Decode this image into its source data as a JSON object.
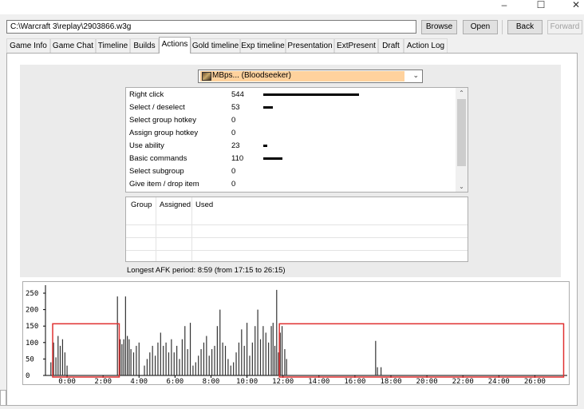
{
  "window": {
    "minimize": "–",
    "maximize": "☐",
    "close": "✕"
  },
  "toolbar": {
    "path": "C:\\Warcraft 3\\replay\\2903866.w3g",
    "browse": "Browse",
    "open": "Open",
    "back": "Back",
    "forward": "Forward"
  },
  "tabs": [
    "Game Info",
    "Game Chat",
    "Timeline",
    "Builds",
    "Actions",
    "Gold timeline",
    "Exp timeline",
    "Presentation",
    "ExtPresent",
    "Draft",
    "Action Log"
  ],
  "active_tab": "Actions",
  "player": {
    "name": "MBps... (Bloodseeker)",
    "highlight_color": "#ffd29d"
  },
  "actions": [
    {
      "name": "Right click",
      "value": 544
    },
    {
      "name": "Select / deselect",
      "value": 53
    },
    {
      "name": "Select group hotkey",
      "value": 0
    },
    {
      "name": "Assign group hotkey",
      "value": 0
    },
    {
      "name": "Use ability",
      "value": 23
    },
    {
      "name": "Basic commands",
      "value": 110
    },
    {
      "name": "Select subgroup",
      "value": 0
    },
    {
      "name": "Give item / drop item",
      "value": 0
    }
  ],
  "group_table": {
    "headers": [
      "Group",
      "Assigned",
      "Used"
    ]
  },
  "afk_text": "Longest AFK period: 8:59 (from 17:15 to 26:15)",
  "chart_data": {
    "type": "bar",
    "y_ticks": [
      "250",
      "200",
      "150",
      "100",
      "50",
      "0"
    ],
    "ylim": [
      0,
      250
    ],
    "x_ticks": [
      "0:00",
      "2:00",
      "4:00",
      "6:00",
      "8:00",
      "10:00",
      "12:00",
      "14:00",
      "16:00",
      "18:00",
      "20:00",
      "22:00",
      "24:00",
      "26:00"
    ],
    "xlim_minutes": [
      -1.2,
      27.8
    ],
    "values": [
      [
        -0.9,
        40
      ],
      [
        -0.75,
        100
      ],
      [
        -0.62,
        55
      ],
      [
        -0.5,
        120
      ],
      [
        -0.38,
        90
      ],
      [
        -0.25,
        110
      ],
      [
        -0.12,
        70
      ],
      [
        0.0,
        30
      ],
      [
        2.8,
        240
      ],
      [
        2.95,
        110
      ],
      [
        3.05,
        95
      ],
      [
        3.15,
        110
      ],
      [
        3.25,
        240
      ],
      [
        3.35,
        120
      ],
      [
        3.45,
        110
      ],
      [
        3.55,
        80
      ],
      [
        3.7,
        70
      ],
      [
        3.85,
        90
      ],
      [
        4.0,
        100
      ],
      [
        4.3,
        30
      ],
      [
        4.45,
        50
      ],
      [
        4.6,
        70
      ],
      [
        4.75,
        90
      ],
      [
        4.9,
        60
      ],
      [
        5.05,
        100
      ],
      [
        5.2,
        130
      ],
      [
        5.35,
        90
      ],
      [
        5.5,
        100
      ],
      [
        5.65,
        70
      ],
      [
        5.8,
        110
      ],
      [
        5.95,
        70
      ],
      [
        6.1,
        90
      ],
      [
        6.25,
        50
      ],
      [
        6.4,
        110
      ],
      [
        6.55,
        150
      ],
      [
        6.7,
        80
      ],
      [
        6.85,
        160
      ],
      [
        7.0,
        30
      ],
      [
        7.15,
        40
      ],
      [
        7.3,
        60
      ],
      [
        7.45,
        80
      ],
      [
        7.6,
        100
      ],
      [
        7.75,
        120
      ],
      [
        7.9,
        60
      ],
      [
        8.05,
        80
      ],
      [
        8.2,
        90
      ],
      [
        8.35,
        150
      ],
      [
        8.5,
        200
      ],
      [
        8.65,
        100
      ],
      [
        8.8,
        90
      ],
      [
        8.95,
        50
      ],
      [
        9.1,
        30
      ],
      [
        9.25,
        40
      ],
      [
        9.4,
        70
      ],
      [
        9.55,
        100
      ],
      [
        9.7,
        140
      ],
      [
        9.85,
        90
      ],
      [
        10.0,
        160
      ],
      [
        10.15,
        60
      ],
      [
        10.3,
        100
      ],
      [
        10.45,
        150
      ],
      [
        10.6,
        200
      ],
      [
        10.75,
        110
      ],
      [
        10.9,
        150
      ],
      [
        11.05,
        130
      ],
      [
        11.2,
        100
      ],
      [
        11.35,
        150
      ],
      [
        11.45,
        160
      ],
      [
        11.55,
        90
      ],
      [
        11.65,
        260
      ],
      [
        11.75,
        70
      ],
      [
        11.85,
        130
      ],
      [
        11.95,
        150
      ],
      [
        12.1,
        80
      ],
      [
        12.2,
        50
      ],
      [
        17.15,
        105
      ],
      [
        17.25,
        25
      ],
      [
        17.45,
        25
      ]
    ],
    "annotation_color": "#e03030",
    "highlights_minutes": [
      [
        -0.8,
        2.9
      ],
      [
        11.8,
        27.6
      ]
    ]
  }
}
